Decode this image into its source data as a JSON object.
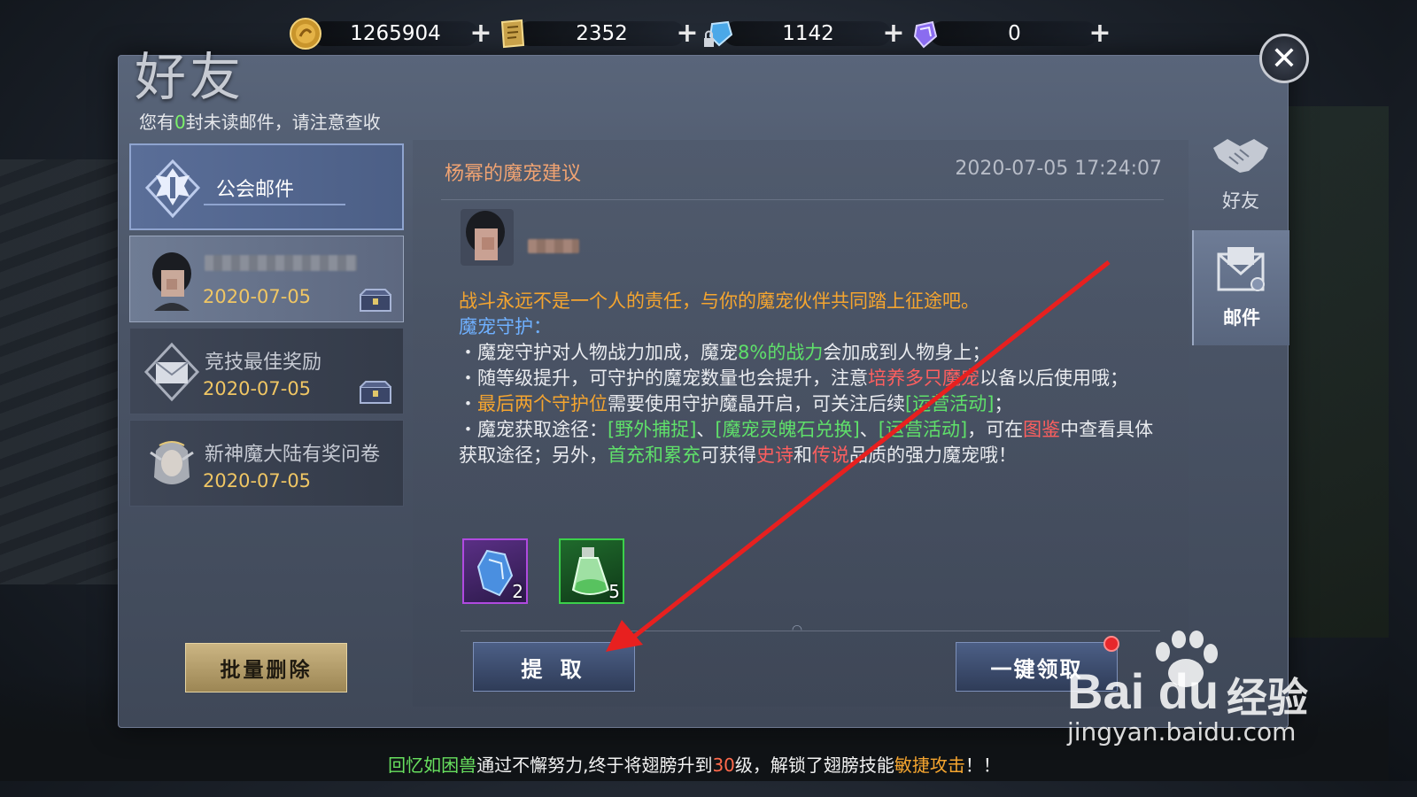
{
  "currencies": [
    {
      "name": "gold-coin",
      "value": "1265904",
      "icon": "gold-coin-icon"
    },
    {
      "name": "voucher",
      "value": "2352",
      "icon": "voucher-icon"
    },
    {
      "name": "locked-diamond",
      "value": "1142",
      "icon": "locked-diamond-icon"
    },
    {
      "name": "diamond",
      "value": "0",
      "icon": "diamond-icon"
    }
  ],
  "plus_label": "+",
  "panel": {
    "title": "好友",
    "notice_prefix": "您有",
    "notice_count": "0",
    "notice_suffix": "封未读邮件，请注意查收",
    "close_label": "✕"
  },
  "side_tabs": [
    {
      "label": "好友",
      "icon": "handshake-icon",
      "active": false
    },
    {
      "label": "邮件",
      "icon": "mail-icon",
      "active": true
    }
  ],
  "mail_list": {
    "group_title": "公会邮件",
    "items": [
      {
        "title": "",
        "date": "2020-07-05",
        "icon": "avatar-icon",
        "has_chest": true
      },
      {
        "title": "竞技最佳奖励",
        "date": "2020-07-05",
        "icon": "envelope-icon",
        "has_chest": true
      },
      {
        "title": "新神魔大陆有奖问卷",
        "date": "2020-07-05",
        "icon": "elf-avatar-icon",
        "has_chest": false
      }
    ],
    "batch_delete_label": "批量删除"
  },
  "mail": {
    "subject": "杨幂的魔宠建议",
    "time": "2020-07-05 17:24:07",
    "body": {
      "intro": "战斗永远不是一个人的责任，与你的魔宠伙伴共同踏上征途吧。",
      "heading": "魔宠守护：",
      "b1_a": "・魔宠守护对人物战力加成，魔宠",
      "b1_hl": "8%的战力",
      "b1_b": "会加成到人物身上；",
      "b2_a": "・随等级提升，可守护的魔宠数量也会提升，注意",
      "b2_hl": "培养多只魔宠",
      "b2_b": "以备以后使用哦；",
      "b3_a": "・",
      "b3_hl": "最后两个守护位",
      "b3_b": "需要使用守护魔晶开启，可关注后续",
      "b3_hl2": "[运营活动]",
      "b3_c": "；",
      "b4_a": "・魔宠获取途径：",
      "b4_hl1": "[野外捕捉]",
      "b4_sep1": "、",
      "b4_hl2": "[魔宠灵魄石兑换]",
      "b4_sep2": "、",
      "b4_hl3": "[运营活动]",
      "b4_b": "，可在",
      "b4_hl4": "图鉴",
      "b4_c": "中查看具体获取途径；另外，",
      "b4_hl5": "首充和累充",
      "b4_d": "可获得",
      "b4_hl6": "史诗",
      "b4_e": "和",
      "b4_hl7": "传说",
      "b4_f": "品质的强力魔宠哦！"
    },
    "rewards": [
      {
        "icon": "purple-crystal-icon",
        "count": "2",
        "border": "#b04ae0"
      },
      {
        "icon": "green-potion-icon",
        "count": "5",
        "border": "#3bd14a"
      }
    ],
    "claim_label": "提 取",
    "claim_all_label": "一键领取"
  },
  "ticker": {
    "name": "回忆如困兽",
    "t1": "通过不懈努力,终于将翅膀升到",
    "level": "30",
    "t2": "级，解锁了翅膀技能",
    "skill": "敏捷攻击",
    "t3": "！！"
  },
  "watermark": {
    "logo": "Bai du",
    "cn": "经验",
    "url": "jingyan.baidu.com"
  },
  "colors": {
    "accent_orange": "#f5a52f",
    "accent_blue": "#6fb0ff",
    "accent_green": "#5fe06a",
    "accent_red": "#ff5f5f",
    "date_gold": "#f0c664",
    "arrow_red": "#e8201f"
  }
}
